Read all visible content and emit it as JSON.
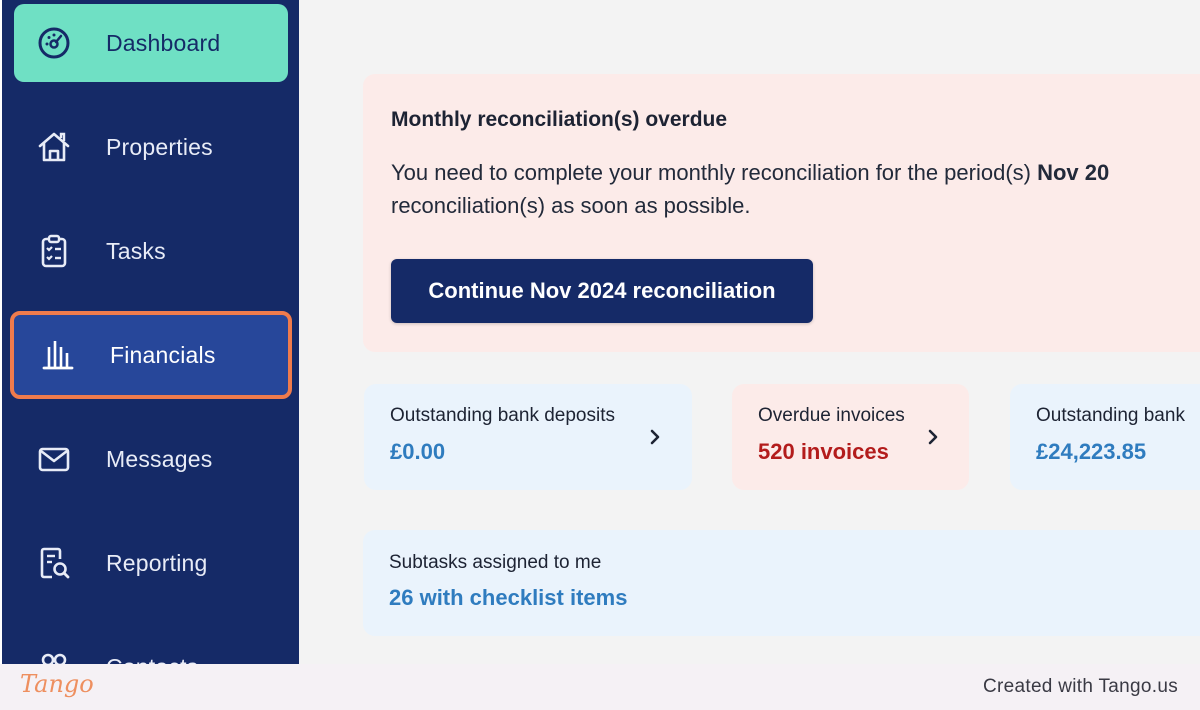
{
  "sidebar": {
    "items": [
      {
        "label": "Dashboard",
        "icon": "dashboard-gauge-icon"
      },
      {
        "label": "Properties",
        "icon": "house-icon"
      },
      {
        "label": "Tasks",
        "icon": "clipboard-checklist-icon"
      },
      {
        "label": "Financials",
        "icon": "bank-building-icon"
      },
      {
        "label": "Messages",
        "icon": "envelope-icon"
      },
      {
        "label": "Reporting",
        "icon": "report-search-icon"
      },
      {
        "label": "Contacts",
        "icon": "people-icon"
      }
    ]
  },
  "alert": {
    "title": "Monthly reconciliation(s) overdue",
    "text_before": "You need to complete your monthly reconciliation for the period(s) ",
    "period": "Nov 20",
    "text_after": "reconciliation(s) as soon as possible.",
    "button_label": "Continue Nov 2024 reconciliation"
  },
  "cards": [
    {
      "label": "Outstanding bank deposits",
      "value": "£0.00"
    },
    {
      "label": "Overdue invoices",
      "value": "520 invoices"
    },
    {
      "label": "Outstanding bank",
      "value": "£24,223.85"
    }
  ],
  "subtasks": {
    "label": "Subtasks assigned to me",
    "value": "26 with checklist items"
  },
  "footer": {
    "brand": "Tango",
    "credit": "Created with Tango.us"
  },
  "colors": {
    "sidebar_bg": "#152a67",
    "active_item": "#6fe0c4",
    "highlight_border": "#ef7b4c",
    "accent_blue": "#2f7cbf",
    "alert_red": "#b31c1c"
  }
}
